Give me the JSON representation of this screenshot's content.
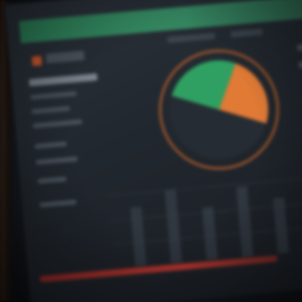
{
  "scene": {
    "colors": {
      "background": "#0d1116",
      "topbar_green": "#2d8a5c",
      "pie_green": "#2fa062",
      "pie_orange": "#e07a35",
      "pie_dark": "#262c33",
      "ring_orange": "#c9662c",
      "bottom_red": "#b83630",
      "text_blur": "#48505a"
    },
    "icons": [
      "app-logo-icon"
    ],
    "pie_segments": [
      {
        "color_key": "pie_green",
        "share": 0.26
      },
      {
        "color_key": "pie_orange",
        "share": 0.24
      },
      {
        "color_key": "pie_dark",
        "share": 0.5
      }
    ]
  }
}
